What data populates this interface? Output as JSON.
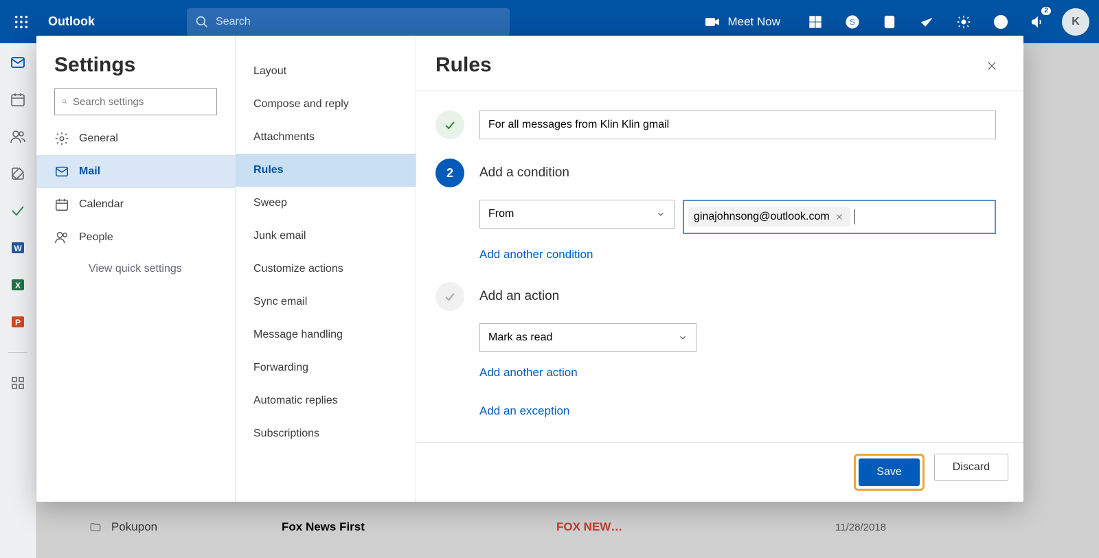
{
  "topbar": {
    "brand": "Outlook",
    "search_placeholder": "Search",
    "meet_now": "Meet Now",
    "notif_badge": "2",
    "avatar_initial": "K"
  },
  "settings_panel": {
    "title": "Settings",
    "search_placeholder": "Search settings",
    "categories": {
      "general": "General",
      "mail": "Mail",
      "calendar": "Calendar",
      "people": "People"
    },
    "quick_link": "View quick settings"
  },
  "mail_subnav": {
    "layout": "Layout",
    "compose": "Compose and reply",
    "attachments": "Attachments",
    "rules": "Rules",
    "sweep": "Sweep",
    "junk": "Junk email",
    "customize": "Customize actions",
    "sync": "Sync email",
    "msghandling": "Message handling",
    "forwarding": "Forwarding",
    "autoreplies": "Automatic replies",
    "subscriptions": "Subscriptions"
  },
  "rules": {
    "title": "Rules",
    "rule_name": "For all messages from Klin Klin gmail",
    "step2_num": "2",
    "add_condition_label": "Add a condition",
    "condition_select": "From",
    "condition_chip": "ginajohnsong@outlook.com",
    "add_another_condition": "Add another condition",
    "add_action_label": "Add an action",
    "action_select": "Mark as read",
    "add_another_action": "Add another action",
    "add_exception": "Add an exception",
    "save": "Save",
    "discard": "Discard"
  },
  "bg": {
    "folder": "Pokupon",
    "from": "Fox News First",
    "subject": "FOX NEW…",
    "date": "11/28/2018"
  }
}
